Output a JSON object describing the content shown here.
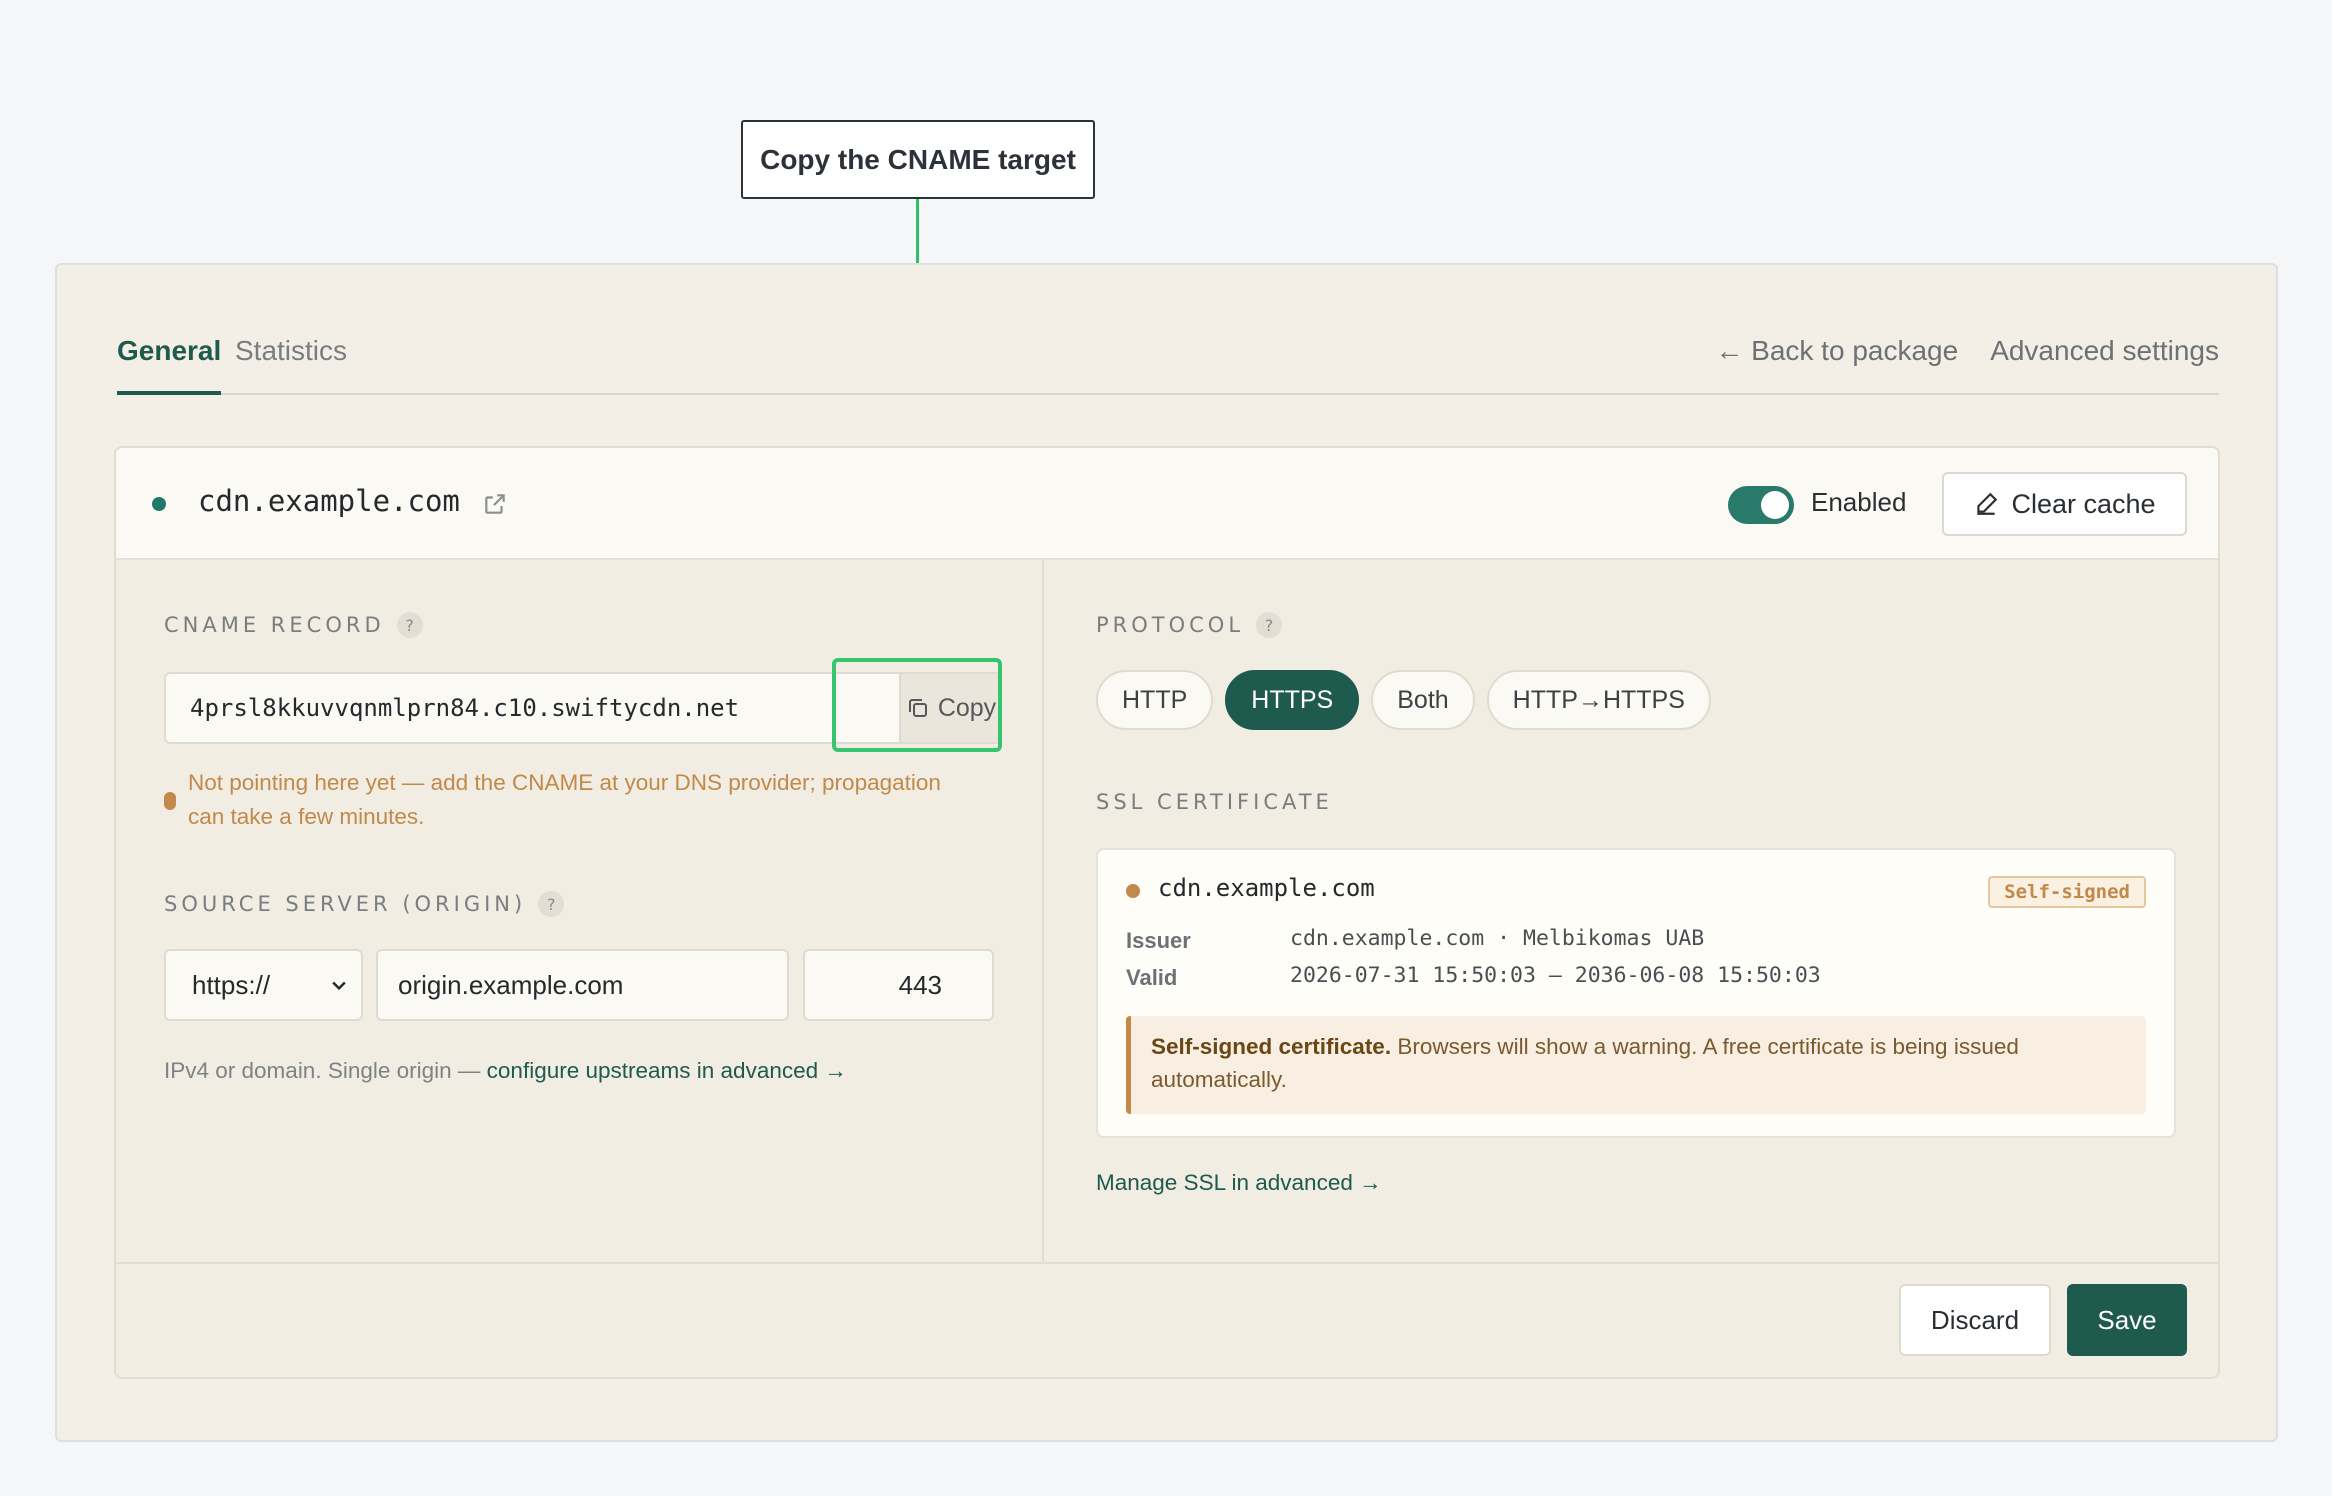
{
  "callout": {
    "text": "Copy the CNAME target"
  },
  "tabs": [
    {
      "label": "General",
      "active": true
    },
    {
      "label": "Statistics",
      "active": false
    }
  ],
  "nav": {
    "back_label": "← Back to package",
    "advanced_label": "Advanced settings"
  },
  "resource": {
    "domain": "cdn.example.com",
    "status_color": "#1f7a6a",
    "enabled": true,
    "enabled_label": "Enabled",
    "clear_cache_label": "Clear cache"
  },
  "cname": {
    "label": "CNAME RECORD",
    "help": "?",
    "value": "4prsl8kkuvvqnmlprn84.c10.swiftycdn.net",
    "copy_label": "Copy",
    "warning": "Not pointing here yet — add the CNAME at your DNS provider; propagation can take a few minutes."
  },
  "origin": {
    "label": "SOURCE SERVER (ORIGIN)",
    "help": "?",
    "scheme": "https://",
    "host": "origin.example.com",
    "port": "443",
    "hint_text": "IPv4 or domain. Single origin — ",
    "hint_link": "configure upstreams in advanced →"
  },
  "protocol": {
    "label": "PROTOCOL",
    "help": "?",
    "options": [
      {
        "label": "HTTP",
        "active": false
      },
      {
        "label": "HTTPS",
        "active": true
      },
      {
        "label": "Both",
        "active": false
      },
      {
        "label": "HTTP→HTTPS",
        "active": false
      }
    ]
  },
  "ssl": {
    "label": "SSL CERTIFICATE",
    "domain": "cdn.example.com",
    "badge": "Self-signed",
    "issuer_label": "Issuer",
    "issuer_value": "cdn.example.com · Melbikomas UAB",
    "valid_label": "Valid",
    "valid_value": "2026-07-31 15:50:03 — 2036-06-08 15:50:03",
    "warning_bold": "Self-signed certificate.",
    "warning_text": " Browsers will show a warning. A free certificate is being issued automatically.",
    "manage_link": "Manage SSL in advanced →"
  },
  "footer": {
    "discard_label": "Discard",
    "save_label": "Save"
  },
  "colors": {
    "accent": "#1f5a4f",
    "warning": "#c2894a",
    "highlight": "#36c46f"
  },
  "icons": [
    "external-link-icon",
    "eraser-icon",
    "copy-icon",
    "chevron-down-icon",
    "help-icon"
  ]
}
